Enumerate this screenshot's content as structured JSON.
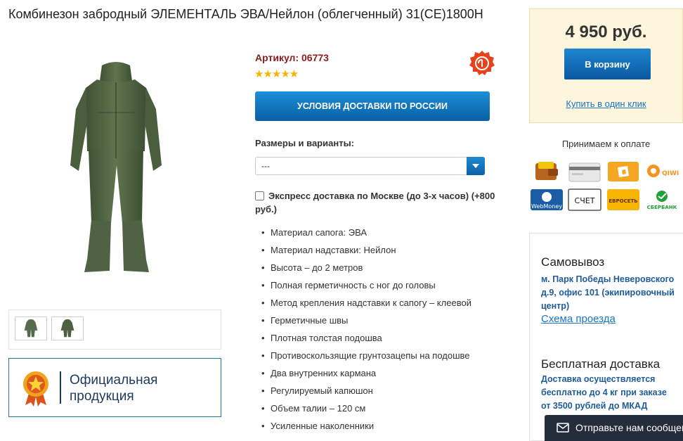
{
  "product": {
    "title": "Комбинезон забродный ЭЛЕМЕНТАЛЬ ЭВА/Нейлон (облегченный) 31(CE)1800Н",
    "sku": "Артикул: 06773",
    "rating_stars": "★★★★★"
  },
  "official": {
    "label_line1": "Официальная",
    "label_line2": "продукция"
  },
  "delivery": {
    "button_label": "УСЛОВИЯ ДОСТАВКИ ПО РОССИИ"
  },
  "options": {
    "sizes_label": "Размеры и варианты:",
    "selected_value": "---"
  },
  "express": {
    "label": "Экспресс доставка по Москве (до 3-х часов) (+800 руб.)"
  },
  "features": [
    "Материал сапога: ЭВА",
    "Материал надставки: Нейлон",
    "Высота – до 2 метров",
    "Полная герметичность с ног до головы",
    "Метод крепления надставки к сапогу – клеевой",
    "Герметичные швы",
    "Плотная толстая подошва",
    "Противоскользящие грунтозацепы на подошве",
    "Два внутренних кармана",
    "Регулируемый капюшон",
    "Объем талии – 120 см",
    "Усиленные наколенники"
  ],
  "buy": {
    "price": "4 950 руб.",
    "cart_label": "В корзину",
    "one_click_label": "Купить в один клик"
  },
  "payment": {
    "title": "Принимаем к оплате",
    "methods": [
      {
        "icon": "wallet-icon"
      },
      {
        "icon": "bank-card-icon"
      },
      {
        "icon": "yandex-money-icon"
      },
      {
        "icon": "qiwi-icon",
        "label": "QIWI"
      },
      {
        "icon": "webmoney-icon",
        "label": "WebMoney"
      },
      {
        "icon": "invoice-icon",
        "label": "СЧЕТ"
      },
      {
        "icon": "euroset-icon",
        "label": "ЕВРОСЕТЬ"
      },
      {
        "icon": "sberbank-icon",
        "label": "СБЕРБАНК"
      }
    ]
  },
  "pickup": {
    "title": "Самовывоз",
    "address": "м. Парк Победы Неверовского д.9, офис 101 (экипировочный центр)",
    "map_link": "Схема проезда"
  },
  "free_delivery": {
    "title": "Бесплатная доставка",
    "text": "Доставка осуществляется бесплатно до 4 кг при заказе от 3500 рублей до МКАД"
  },
  "chat": {
    "label": "Отправьте нам сообщение"
  },
  "colors": {
    "accent_blue": "#0b5fa4",
    "link_blue": "#1a74c6",
    "sku_red": "#8a1c1c",
    "price_box_bg": "#fdf6dd",
    "suit_green": "#556b4a"
  }
}
